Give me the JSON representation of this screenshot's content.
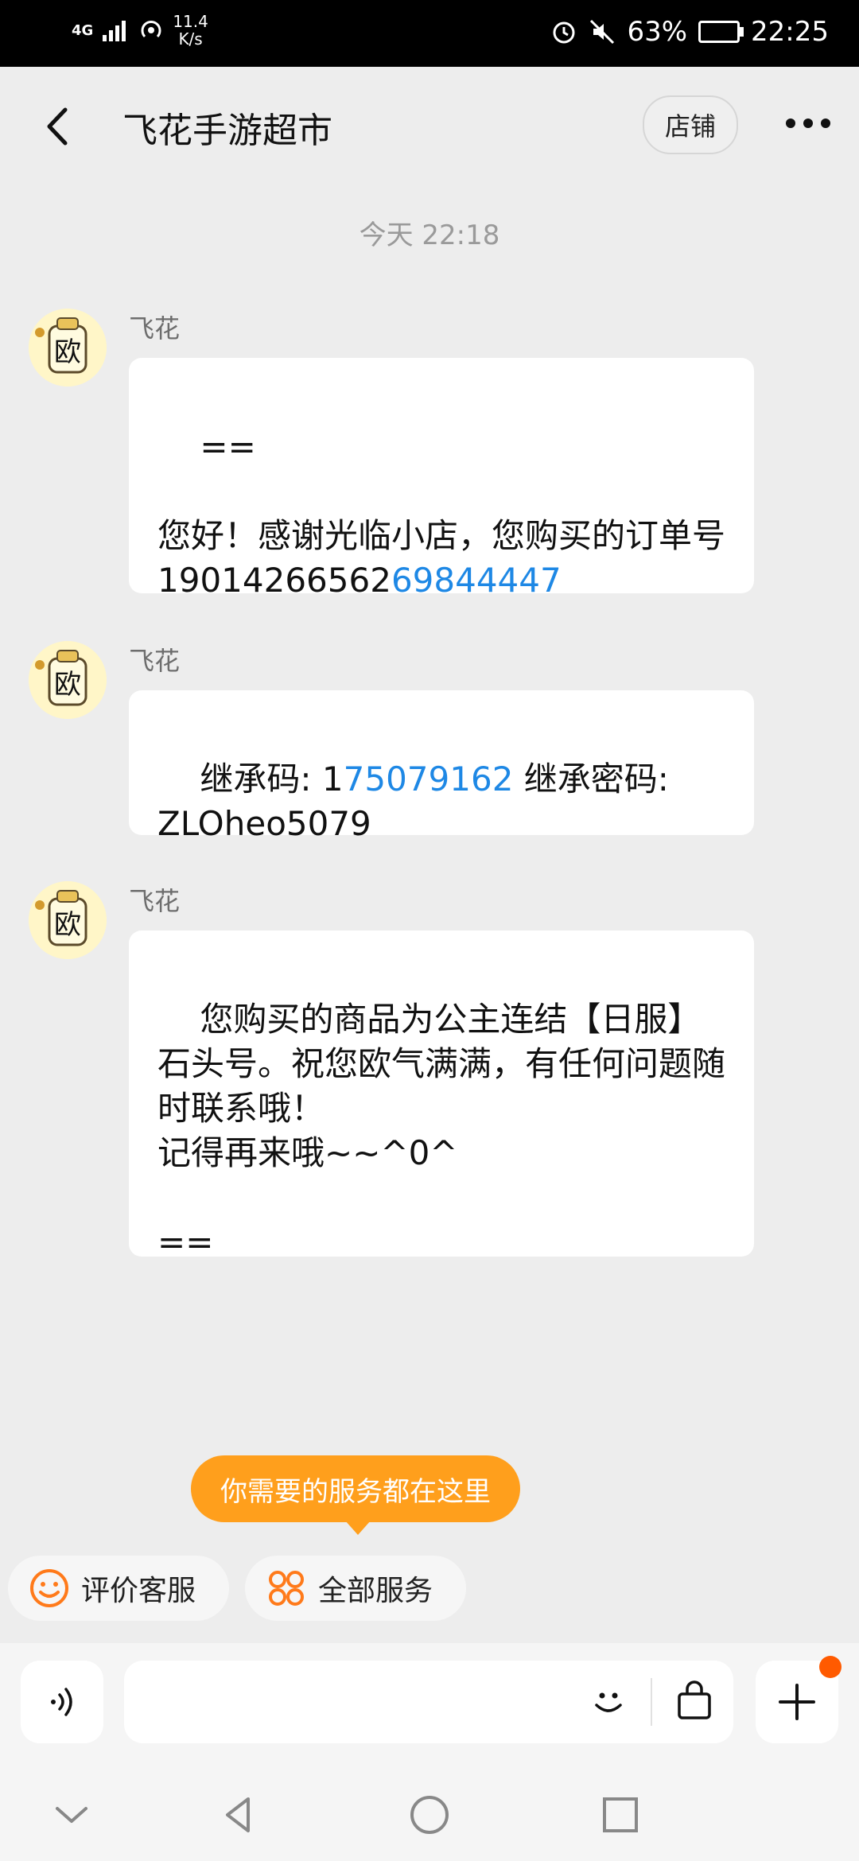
{
  "status_bar": {
    "network": "4G",
    "speed_value": "11.4",
    "speed_unit": "K/s",
    "battery": "63%",
    "time": "22:25"
  },
  "header": {
    "title": "飞花手游超市",
    "shop_button": "店铺"
  },
  "timestamp": "今天  22:18",
  "messages": [
    {
      "sender": "飞花",
      "parts": [
        {
          "text": "==\n\n您好！感谢光临小店，您购买的订单号19014266562",
          "link": false
        },
        {
          "text": "69844447",
          "link": true
        }
      ]
    },
    {
      "sender": "飞花",
      "parts": [
        {
          "text": "继承码: 1",
          "link": false
        },
        {
          "text": "75079162",
          "link": true
        },
        {
          "text": " 继承密码:\nZLOheo5079",
          "link": false
        }
      ]
    },
    {
      "sender": "飞花",
      "parts": [
        {
          "text": "您购买的商品为公主连结【日服】石头号。祝您欧气满满，有任何问题随时联系哦！\n记得再来哦~~^0^\n\n==",
          "link": false
        }
      ]
    }
  ],
  "tooltip": "你需要的服务都在这里",
  "quick_actions": {
    "rate": "评价客服",
    "all_services": "全部服务"
  },
  "input": {
    "placeholder": ""
  },
  "colors": {
    "accent": "#ff9f1c",
    "link": "#1e88e5",
    "badge": "#ff5a00"
  },
  "icons": [
    "back-icon",
    "more-icon",
    "avatar",
    "smile-icon",
    "services-icon",
    "voice-icon",
    "emoji-icon",
    "bag-icon",
    "plus-icon"
  ]
}
